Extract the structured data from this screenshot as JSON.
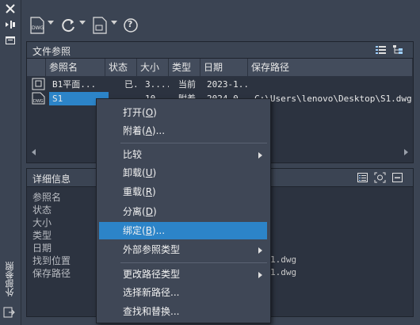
{
  "palette": "外部参照",
  "icons": {
    "close": "close-icon",
    "auto_hide": "auto-hide-icon",
    "properties": "properties-icon",
    "attach_dwg": "attach-dwg-icon",
    "refresh": "refresh-icon",
    "change_path": "change-path-icon",
    "help": "help-icon",
    "list_view": "list-view-icon",
    "tree_view": "tree-view-icon"
  },
  "toolbar": {
    "help_label": "?"
  },
  "file_refs": {
    "title": "文件参照",
    "columns": [
      "参照名",
      "状态",
      "大小",
      "类型",
      "日期",
      "保存路径"
    ],
    "rows": [
      {
        "name": "B1平面...",
        "status": "已...",
        "size": "3....",
        "type": "当前",
        "date": "2023-1...",
        "path": ""
      },
      {
        "name": "S1",
        "status": "已",
        "size": "10",
        "type": "附着",
        "date": "2024-0",
        "path": "C:\\Users\\lenovo\\Desktop\\S1.dwg"
      }
    ]
  },
  "details": {
    "title": "详细信息",
    "labels": [
      "参照名",
      "状态",
      "大小",
      "类型",
      "日期",
      "找到位置",
      "保存路径"
    ],
    "found_at_value": "1.dwg",
    "saved_path_value": "1.dwg"
  },
  "context_menu": {
    "items": [
      {
        "text": "打开(",
        "key": "O",
        "tail": ")",
        "submenu": false
      },
      {
        "text": "附着(",
        "key": "A",
        "tail": ")...",
        "submenu": false
      },
      {
        "text": "比较",
        "key": "",
        "tail": "",
        "submenu": true
      },
      {
        "text": "卸载(",
        "key": "U",
        "tail": ")",
        "submenu": false
      },
      {
        "text": "重载(",
        "key": "R",
        "tail": ")",
        "submenu": false
      },
      {
        "text": "分离(",
        "key": "D",
        "tail": ")",
        "submenu": false
      },
      {
        "text": "绑定(",
        "key": "B",
        "tail": ")...",
        "submenu": false,
        "highlighted": true
      },
      {
        "text": "外部参照类型",
        "key": "",
        "tail": "",
        "submenu": true
      },
      {
        "text": "更改路径类型",
        "key": "",
        "tail": "",
        "submenu": true
      },
      {
        "text": "选择新路径...",
        "key": "",
        "tail": "",
        "submenu": false
      },
      {
        "text": "查找和替换...",
        "key": "",
        "tail": "",
        "submenu": false
      }
    ]
  },
  "colors": {
    "highlight": "#2c84c8",
    "background": "#3b4453"
  }
}
